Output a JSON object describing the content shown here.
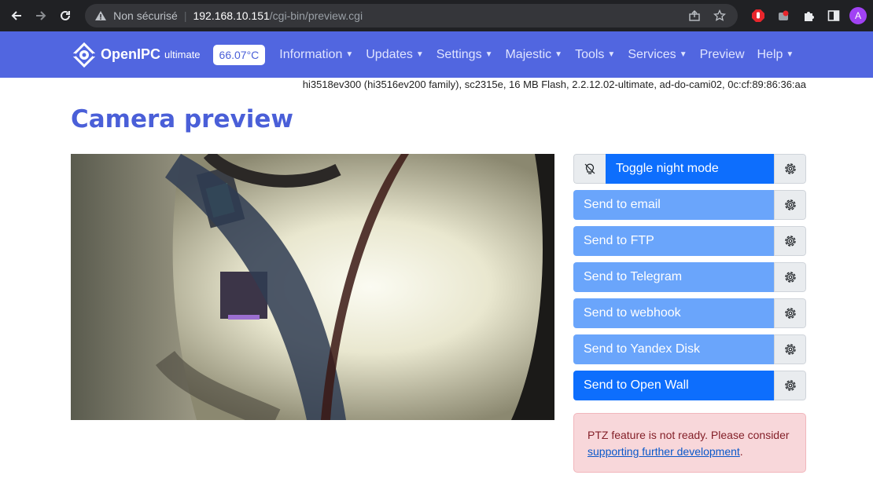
{
  "browser": {
    "security_label": "Non sécurisé",
    "url_host": "192.168.10.151",
    "url_path": "/cgi-bin/preview.cgi",
    "avatar_letter": "A"
  },
  "navbar": {
    "brand_name": "OpenIPC",
    "brand_sub": "ultimate",
    "temperature": "66.07°C",
    "menu": [
      {
        "label": "Information",
        "dropdown": true
      },
      {
        "label": "Updates",
        "dropdown": true
      },
      {
        "label": "Settings",
        "dropdown": true
      },
      {
        "label": "Majestic",
        "dropdown": true
      },
      {
        "label": "Tools",
        "dropdown": true
      },
      {
        "label": "Services",
        "dropdown": true
      },
      {
        "label": "Preview",
        "dropdown": false
      },
      {
        "label": "Help",
        "dropdown": true
      }
    ]
  },
  "device_info": "hi3518ev300 (hi3516ev200 family), sc2315e, 16 MB Flash, 2.2.12.02-ultimate, ad-do-cami02, 0c:cf:89:86:36:aa",
  "page_title": "Camera preview",
  "actions": {
    "night_mode": "Toggle night mode",
    "email": "Send to email",
    "ftp": "Send to FTP",
    "telegram": "Send to Telegram",
    "webhook": "Send to webhook",
    "yandex": "Send to Yandex Disk",
    "openwall": "Send to Open Wall"
  },
  "alert": {
    "text": "PTZ feature is not ready. Please consider ",
    "link": "supporting further development",
    "suffix": "."
  }
}
